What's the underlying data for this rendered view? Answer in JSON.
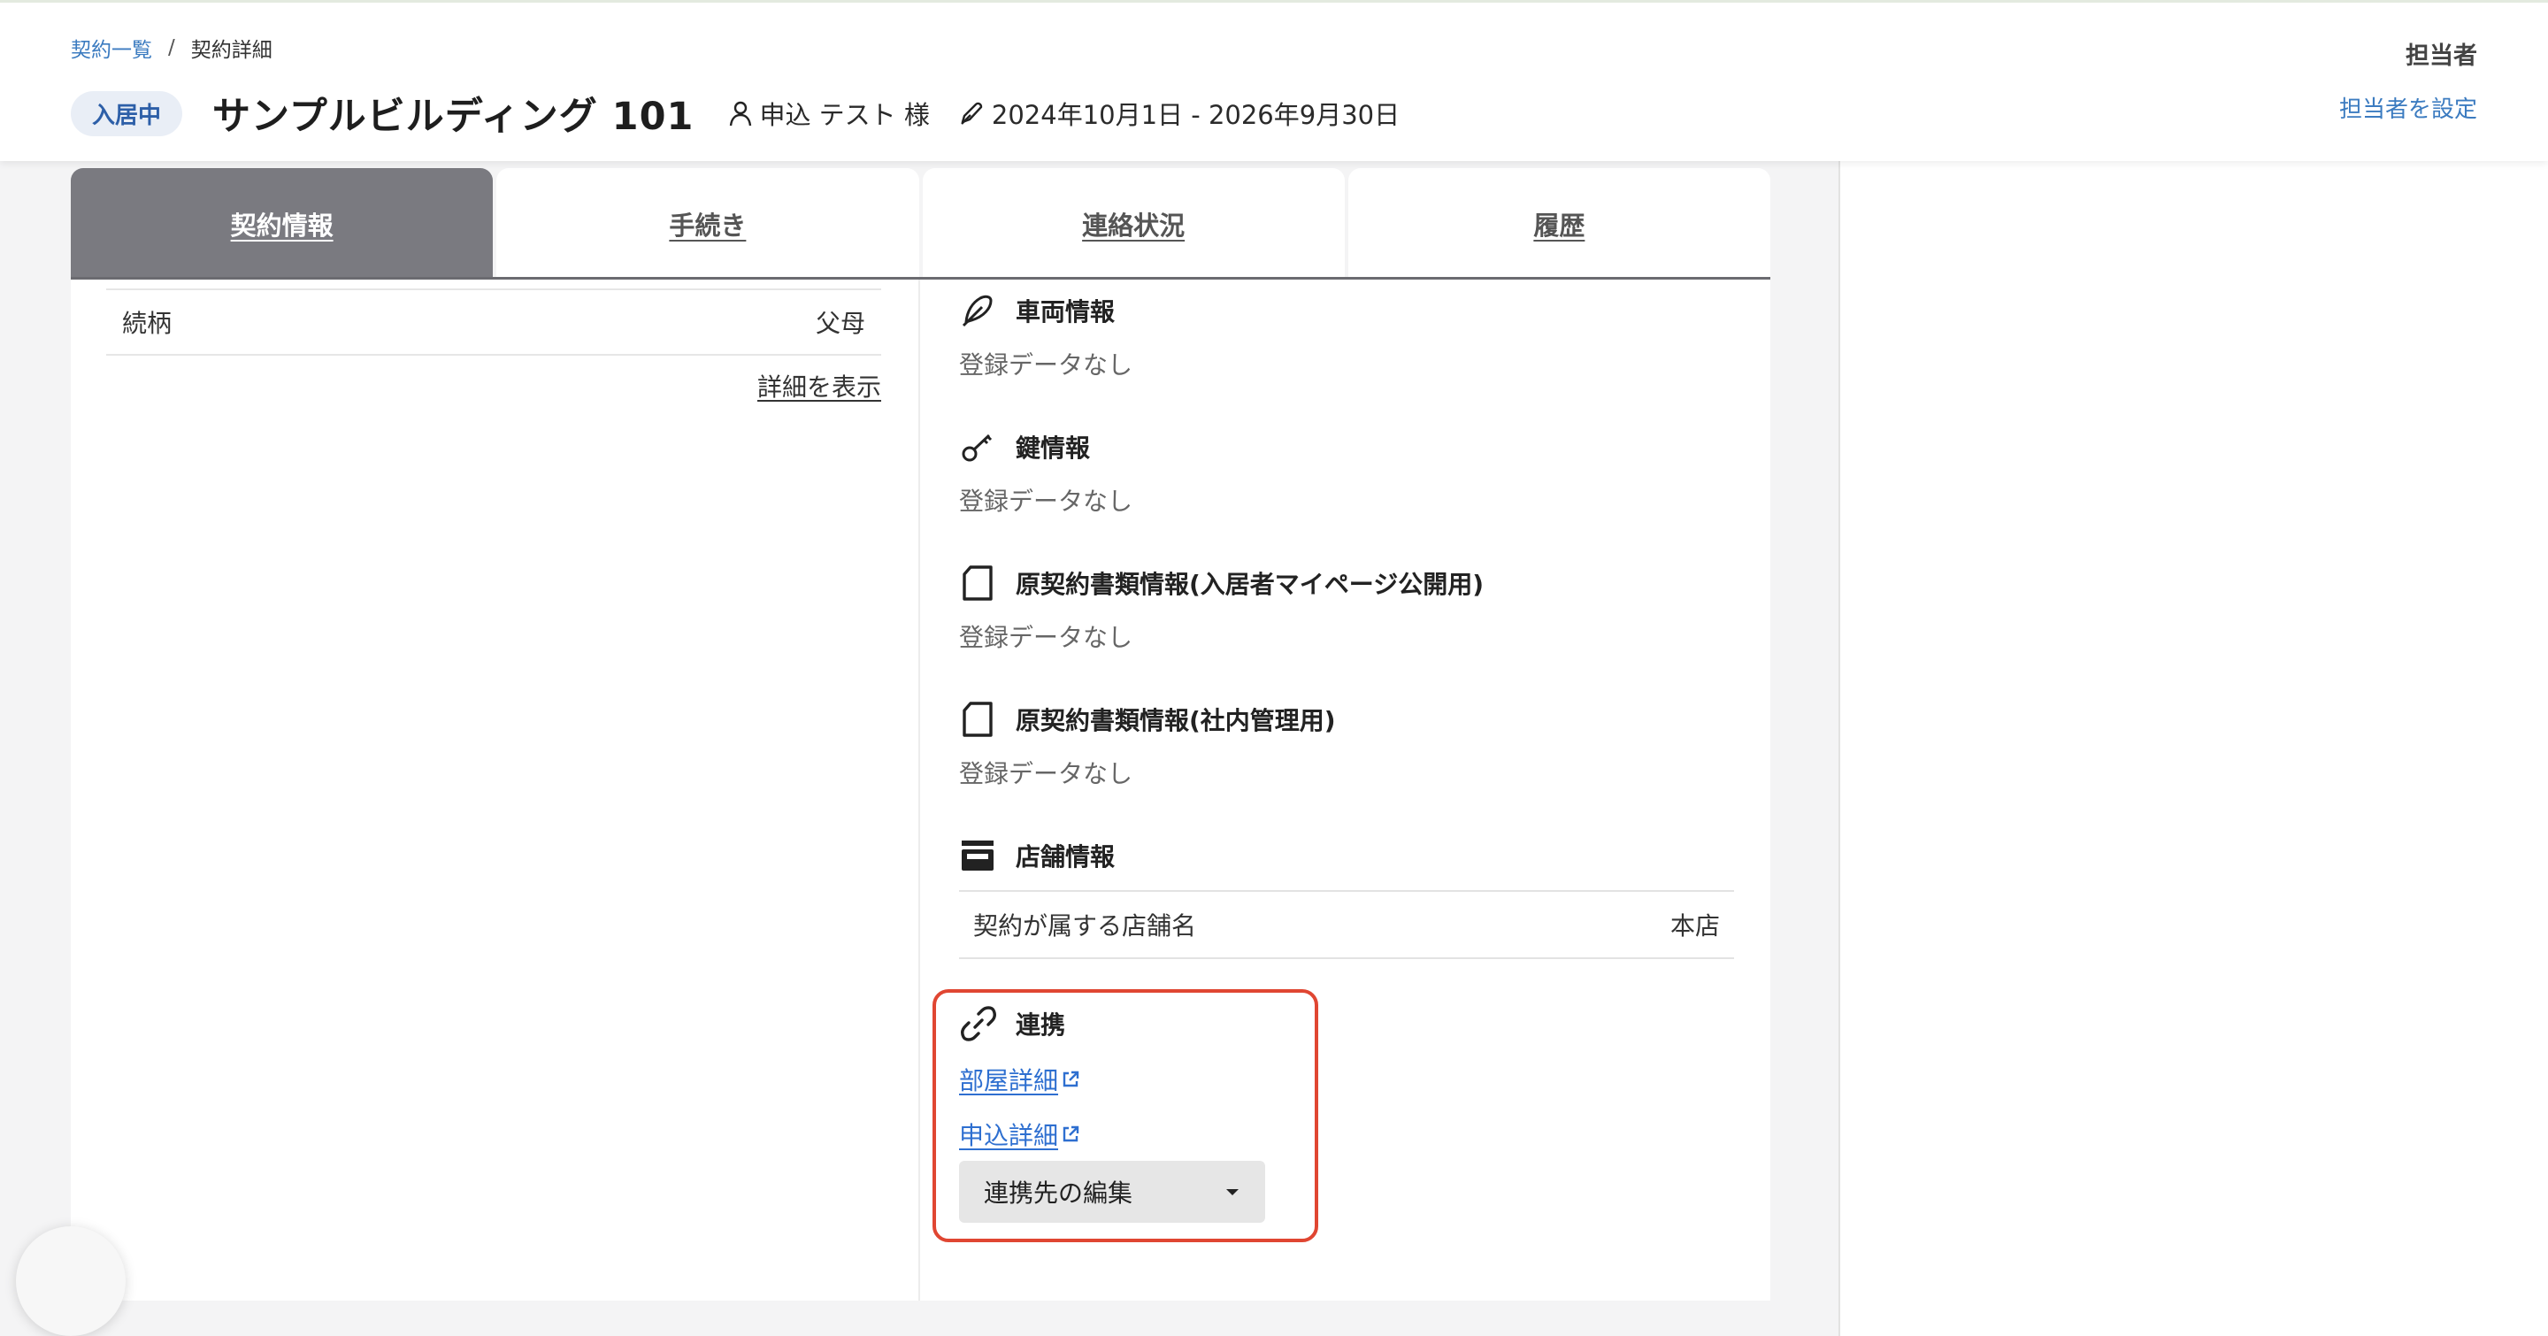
{
  "breadcrumb": {
    "parent": "契約一覧",
    "separator": "/",
    "current": "契約詳細"
  },
  "header": {
    "status": "入居中",
    "property_name": "サンプルビルディング 101",
    "applicant": "申込 テスト 様",
    "period": "2024年10月1日 - 2026年9月30日",
    "assignee_label": "担当者",
    "assignee_link": "担当者を設定",
    "icons": {
      "applicant": "person-icon",
      "period": "pen-icon"
    }
  },
  "tabs": [
    {
      "label": "契約情報",
      "active": true
    },
    {
      "label": "手続き",
      "active": false
    },
    {
      "label": "連絡状況",
      "active": false
    },
    {
      "label": "履歴",
      "active": false
    }
  ],
  "left": {
    "relation_label": "続柄",
    "relation_value": "父母",
    "detail_link": "詳細を表示"
  },
  "sections": {
    "vehicle": {
      "title": "車両情報",
      "empty": "登録データなし",
      "icon": "feather-icon"
    },
    "key": {
      "title": "鍵情報",
      "empty": "登録データなし",
      "icon": "key-icon"
    },
    "contract_docs_public": {
      "title": "原契約書類情報(入居者マイページ公開用)",
      "empty": "登録データなし",
      "icon": "document-icon"
    },
    "contract_docs_internal": {
      "title": "原契約書類情報(社内管理用)",
      "empty": "登録データなし",
      "icon": "document-icon"
    },
    "store": {
      "title": "店舗情報",
      "row_label": "契約が属する店舗名",
      "row_value": "本店",
      "icon": "store-icon"
    },
    "integration": {
      "title": "連携",
      "room_link": "部屋詳細",
      "application_link": "申込詳細",
      "edit_button": "連携先の編集",
      "icon": "link-icon"
    }
  },
  "colors": {
    "accent_link": "#3b7bc0",
    "active_tab": "#7a7a80",
    "highlight": "#e04632",
    "badge_bg": "#e9eef6",
    "badge_text": "#2d5fa8"
  }
}
